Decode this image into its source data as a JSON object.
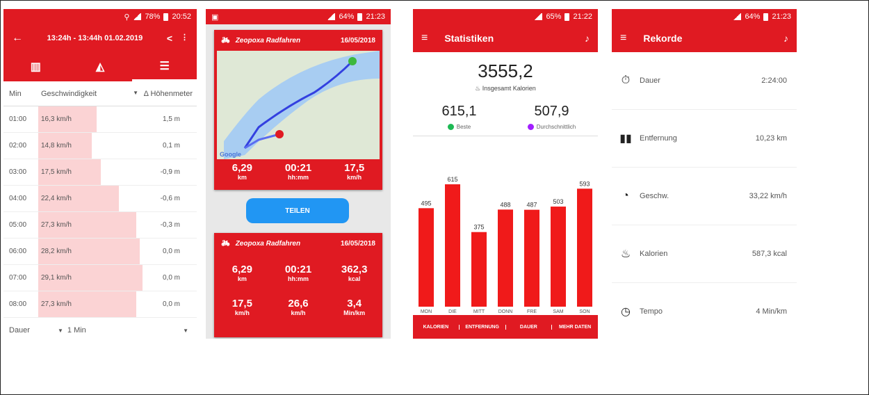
{
  "s1": {
    "status_time": "20:52",
    "status_batt": "78%",
    "title": "13:24h - 13:44h  01.02.2019",
    "col_min": "Min",
    "col_speed": "Geschwindigkeit",
    "col_alt": "Δ Höhenmeter",
    "rows": [
      {
        "min": "01:00",
        "speed": "16,3 km/h",
        "alt": "1,5 m",
        "frac": 0.56
      },
      {
        "min": "02:00",
        "speed": "14,8 km/h",
        "alt": "0,1 m",
        "frac": 0.51
      },
      {
        "min": "03:00",
        "speed": "17,5 km/h",
        "alt": "-0,9 m",
        "frac": 0.6
      },
      {
        "min": "04:00",
        "speed": "22,4 km/h",
        "alt": "-0,6 m",
        "frac": 0.77
      },
      {
        "min": "05:00",
        "speed": "27,3 km/h",
        "alt": "-0,3 m",
        "frac": 0.94
      },
      {
        "min": "06:00",
        "speed": "28,2 km/h",
        "alt": "0,0 m",
        "frac": 0.97
      },
      {
        "min": "07:00",
        "speed": "29,1 km/h",
        "alt": "0,0 m",
        "frac": 1.0
      },
      {
        "min": "08:00",
        "speed": "27,3 km/h",
        "alt": "0,0 m",
        "frac": 0.94
      }
    ],
    "footer_left": "Dauer",
    "footer_right": "1 Min"
  },
  "s2": {
    "status_time": "21:23",
    "status_batt": "64%",
    "card_title": "Zeopoxa Radfahren",
    "card_date": "16/05/2018",
    "map_google": "Google",
    "map_stats": [
      {
        "v": "6,29",
        "u": "km"
      },
      {
        "v": "00:21",
        "u": "hh:mm"
      },
      {
        "v": "17,5",
        "u": "km/h"
      }
    ],
    "share": "TEILEN",
    "card2_title": "Zeopoxa Radfahren",
    "card2_date": "16/05/2018",
    "stats_row1": [
      {
        "v": "6,29",
        "u": "km"
      },
      {
        "v": "00:21",
        "u": "hh:mm"
      },
      {
        "v": "362,3",
        "u": "kcal"
      }
    ],
    "stats_row2": [
      {
        "v": "17,5",
        "u": "km/h"
      },
      {
        "v": "26,6",
        "u": "km/h"
      },
      {
        "v": "3,4",
        "u": "Min/km"
      }
    ]
  },
  "s3": {
    "status_time": "21:22",
    "status_batt": "65%",
    "title": "Statistiken",
    "total": "3555,2",
    "total_label": "Insgesamt Kalorien",
    "best": "615,1",
    "best_label": "Beste",
    "avg": "507,9",
    "avg_label": "Durchschnittlich",
    "tabs": [
      "KALORIEN",
      "ENTFERNUNG",
      "DAUER",
      "MEHR DATEN"
    ]
  },
  "chart_data": {
    "type": "bar",
    "categories": [
      "MON",
      "DIE",
      "MITT",
      "DONN",
      "FRE",
      "SAM",
      "SON"
    ],
    "values": [
      495,
      615,
      375,
      488,
      487,
      503,
      593
    ],
    "ylim": [
      0,
      650
    ]
  },
  "s4": {
    "status_time": "21:23",
    "status_batt": "64%",
    "title": "Rekorde",
    "records": [
      {
        "icon": "⏱",
        "label": "Dauer",
        "value": "2:24:00"
      },
      {
        "icon": "▮▮",
        "label": "Entfernung",
        "value": "10,23 km"
      },
      {
        "icon": "◔",
        "label": "Geschw.",
        "value": "33,22 km/h"
      },
      {
        "icon": "♨",
        "label": "Kalorien",
        "value": "587,3 kcal"
      },
      {
        "icon": "◷",
        "label": "Tempo",
        "value": "4 Min/km"
      }
    ]
  },
  "colors": {
    "accent": "#e01a22",
    "bar_fill": "#fbd3d4",
    "share": "#2196f3",
    "best": "#1db954",
    "avg": "#a21fff"
  }
}
